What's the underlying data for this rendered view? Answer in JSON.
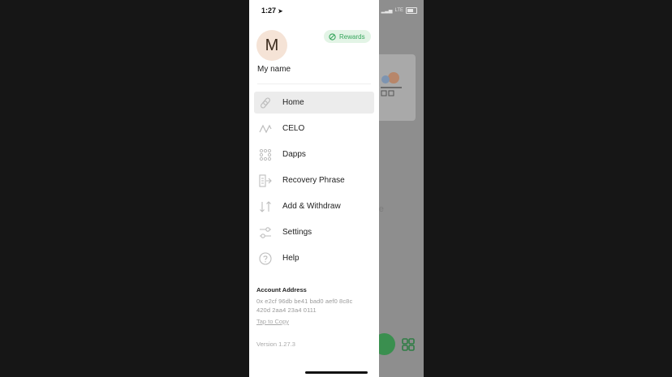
{
  "status_bar": {
    "time": "1:27",
    "network": "LTE"
  },
  "profile": {
    "avatar_initial": "M",
    "name": "My name"
  },
  "rewards": {
    "label": "Rewards",
    "icon": "rewards-icon"
  },
  "nav": {
    "items": [
      {
        "label": "Home",
        "icon": "link-icon",
        "active": true
      },
      {
        "label": "CELO",
        "icon": "wave-icon"
      },
      {
        "label": "Dapps",
        "icon": "dots-grid-icon"
      },
      {
        "label": "Recovery Phrase",
        "icon": "recovery-phrase-icon"
      },
      {
        "label": "Add & Withdraw",
        "icon": "up-down-arrows-icon"
      },
      {
        "label": "Settings",
        "icon": "sliders-icon"
      },
      {
        "label": "Help",
        "icon": "help-icon"
      }
    ]
  },
  "account": {
    "title": "Account Address",
    "address_line1": "0x e2cf 96db be41 bad0 aef0 8c8c",
    "address_line2": "420d 2aa4 23a4 0111",
    "copy_label": "Tap to Copy"
  },
  "version": "Version 1.27.3",
  "background": {
    "text": "ere"
  },
  "colors": {
    "accent": "#35a55b",
    "rewards_bg": "#e3f4e6",
    "avatar_bg": "#f5e3d6",
    "overlay": "#8e8e8e",
    "fab": "#3a8f4f"
  }
}
